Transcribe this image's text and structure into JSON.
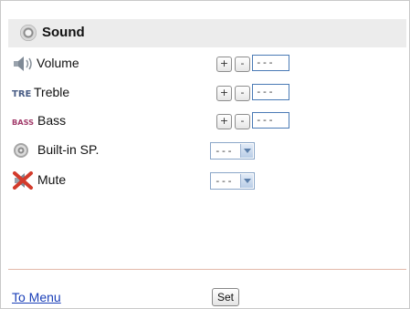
{
  "header": {
    "title": "Sound",
    "icon": "speaker-round-icon"
  },
  "rows": [
    {
      "label": "Volume",
      "icon": "volume-speaker-icon",
      "value": "---",
      "plus": "+",
      "minus": "-"
    },
    {
      "label": "Treble",
      "icon": "treble-icon",
      "icon_text": "TRE",
      "value": "---",
      "plus": "+",
      "minus": "-"
    },
    {
      "label": "Bass",
      "icon": "bass-icon",
      "icon_text": "BASS",
      "value": "---",
      "plus": "+",
      "minus": "-"
    },
    {
      "label": "Built-in SP.",
      "icon": "speaker-round-icon",
      "selected": "---"
    },
    {
      "label": "Mute",
      "icon": "mute-icon",
      "selected": "---"
    }
  ],
  "footer": {
    "menu_link": "To Menu",
    "set_label": "Set"
  },
  "colors": {
    "link": "#1a3fb8",
    "divider": "#e3b8a9",
    "header_bg": "#ececec",
    "mute_red": "#d33b2c"
  }
}
